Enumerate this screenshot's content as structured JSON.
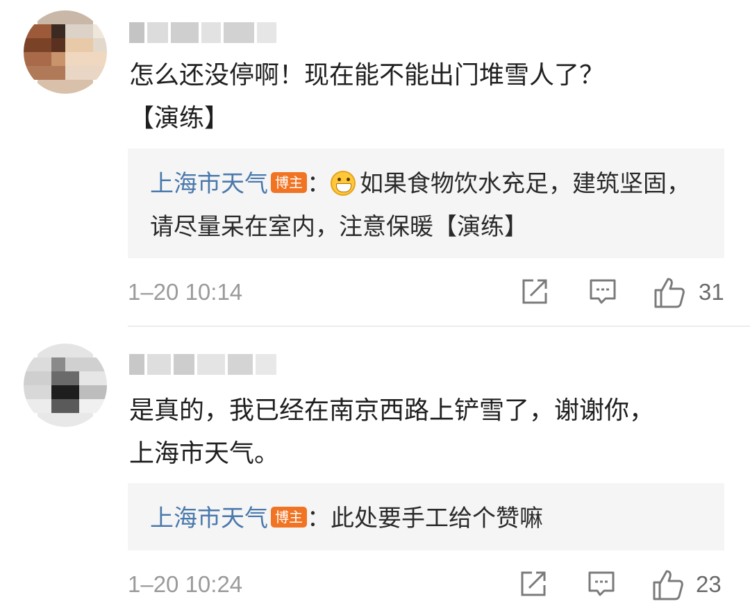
{
  "comments": [
    {
      "text": "怎么还没停啊！现在能不能出门堆雪人了？\n【演练】",
      "reply": {
        "author": "上海市天气",
        "badge": "博主",
        "separator": "：",
        "emoji": "grin-emoji",
        "text": "如果食物饮水充足，建筑坚固，请尽量呆在室内，注意保暖【演练】"
      },
      "timestamp": "1–20 10:14",
      "likes": "31"
    },
    {
      "text": "是真的，我已经在南京西路上铲雪了，谢谢你，上海市天气。",
      "reply": {
        "author": "上海市天气",
        "badge": "博主",
        "separator": "：",
        "text": "此处要手工给个赞嘛"
      },
      "timestamp": "1–20 10:24",
      "likes": "23"
    }
  ],
  "icons": {
    "forward": "forward-icon",
    "reply": "comment-icon",
    "like": "thumbs-up-icon"
  },
  "colors": {
    "author_link": "#4a79ac",
    "badge": "#f07423",
    "reply_bg": "#f5f5f5",
    "meta_text": "#9a9a9a"
  }
}
